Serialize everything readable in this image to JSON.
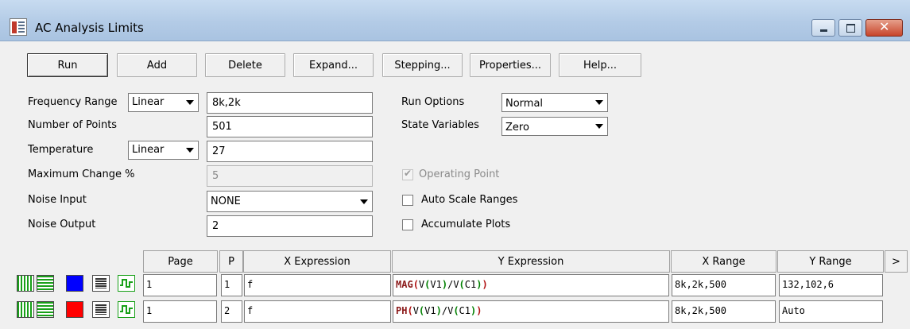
{
  "window": {
    "title": "AC Analysis Limits",
    "icons": [
      "app-icon",
      "minimize-icon",
      "maximize-icon",
      "close-icon"
    ]
  },
  "toolbar": {
    "run": "Run",
    "add": "Add",
    "delete": "Delete",
    "expand": "Expand...",
    "stepping": "Stepping...",
    "properties": "Properties...",
    "help": "Help..."
  },
  "form": {
    "frequency_range_label": "Frequency Range",
    "frequency_range_mode": "Linear",
    "frequency_range_value": "8k,2k",
    "number_of_points_label": "Number of Points",
    "number_of_points_value": "501",
    "temperature_label": "Temperature",
    "temperature_mode": "Linear",
    "temperature_value": "27",
    "max_change_label": "Maximum Change %",
    "max_change_value": "5",
    "noise_input_label": "Noise Input",
    "noise_input_value": "NONE",
    "noise_output_label": "Noise Output",
    "noise_output_value": "2",
    "run_options_label": "Run Options",
    "run_options_value": "Normal",
    "state_variables_label": "State Variables",
    "state_variables_value": "Zero",
    "operating_point_label": "Operating Point",
    "operating_point_checked": true,
    "auto_scale_label": "Auto Scale Ranges",
    "auto_scale_checked": false,
    "accumulate_label": "Accumulate Plots",
    "accumulate_checked": false
  },
  "grid": {
    "headers": {
      "page": "Page",
      "p": "P",
      "x_expression": "X Expression",
      "y_expression": "Y Expression",
      "x_range": "X Range",
      "y_range": "Y Range",
      "more": ">"
    },
    "rows": [
      {
        "color": "#0000ff",
        "page": "1",
        "p": "1",
        "x_expression": "f",
        "y_expression": {
          "fn": "MAG",
          "open": "(",
          "inner1": "V",
          "inner1_open": "(",
          "arg1": "V1",
          "inner1_close": ")",
          "div": "/",
          "inner2": "V",
          "inner2_open": "(",
          "arg2": "C1",
          "inner2_close": ")",
          "close": ")"
        },
        "x_range": "8k,2k,500",
        "y_range": "132,102,6"
      },
      {
        "color": "#ff0000",
        "page": "1",
        "p": "2",
        "x_expression": "f",
        "y_expression": {
          "fn": "PH",
          "open": "(",
          "inner1": "V",
          "inner1_open": "(",
          "arg1": "V1",
          "inner1_close": ")",
          "div": "/",
          "inner2": "V",
          "inner2_open": "(",
          "arg2": "C1",
          "inner2_close": ")",
          "close": ")"
        },
        "x_range": "8k,2k,500",
        "y_range": "Auto"
      }
    ],
    "expression_colors": {
      "function": "#8b1a1a",
      "paren_outer": "#b01010",
      "paren_inner": "#008000"
    }
  }
}
